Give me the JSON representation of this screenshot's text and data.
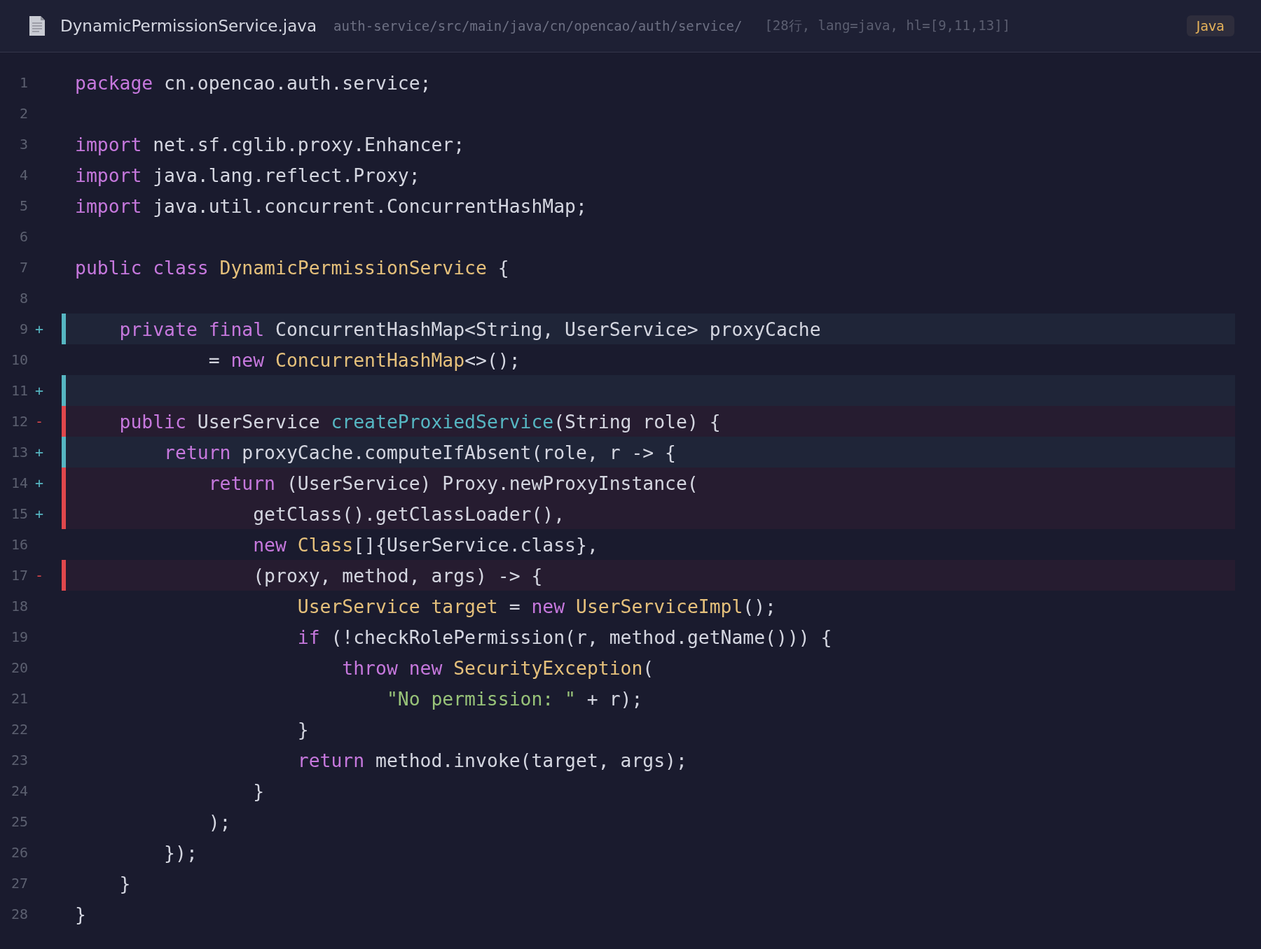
{
  "file": {
    "name": "DynamicPermissionService.java",
    "path": "auth-service/src/main/java/cn/opencao/auth/service/",
    "meta": "[28行, lang=java, hl=[9,11,13]]",
    "language": "Java"
  },
  "lines": [
    {
      "number": "1",
      "kind": "context",
      "tokens": [
        {
          "kind": "kw",
          "text": "package "
        },
        {
          "kind": "plain",
          "text": "cn.opencao.auth.service;"
        }
      ]
    },
    {
      "number": "2",
      "kind": "context"
    },
    {
      "number": "3",
      "kind": "context",
      "tokens": [
        {
          "kind": "kw",
          "text": "import "
        },
        {
          "kind": "plain",
          "text": "net.sf.cglib.proxy.Enhancer;"
        }
      ]
    },
    {
      "number": "4",
      "kind": "context",
      "tokens": [
        {
          "kind": "kw",
          "text": "import "
        },
        {
          "kind": "plain",
          "text": "java.lang.reflect.Proxy;"
        }
      ]
    },
    {
      "number": "5",
      "kind": "context",
      "tokens": [
        {
          "kind": "kw",
          "text": "import "
        },
        {
          "kind": "plain",
          "text": "java.util.concurrent.ConcurrentHashMap;"
        }
      ]
    },
    {
      "number": "6",
      "kind": "context"
    },
    {
      "number": "7",
      "kind": "context",
      "tokens": [
        {
          "kind": "kw",
          "text": "public class "
        },
        {
          "kind": "type",
          "text": "DynamicPermissionService"
        },
        {
          "kind": "plain",
          "text": " {"
        }
      ]
    },
    {
      "number": "8",
      "kind": "context"
    },
    {
      "number": "9",
      "marker": "+",
      "kind": "added",
      "tokens": [
        {
          "kind": "kw",
          "text": "    private final"
        },
        {
          "kind": "plain",
          "text": " ConcurrentHashMap<String, UserService> proxyCache"
        }
      ]
    },
    {
      "number": "10",
      "kind": "context",
      "tokens": [
        {
          "kind": "plain",
          "text": "            = "
        },
        {
          "kind": "kw",
          "text": "new "
        },
        {
          "kind": "type",
          "text": "ConcurrentHashMap"
        },
        {
          "kind": "plain",
          "text": "<>();"
        }
      ]
    },
    {
      "number": "11",
      "marker": "+",
      "kind": "added"
    },
    {
      "number": "12",
      "marker": "-",
      "kind": "removed",
      "tokens": [
        {
          "kind": "kw",
          "text": "    public"
        },
        {
          "kind": "plain",
          "text": " UserService "
        },
        {
          "kind": "fn",
          "text": "createProxiedService"
        },
        {
          "kind": "plain",
          "text": "(String role) {"
        }
      ]
    },
    {
      "number": "13",
      "marker": "+",
      "kind": "added",
      "tokens": [
        {
          "kind": "kw",
          "text": "        return"
        },
        {
          "kind": "plain",
          "text": " proxyCache.computeIfAbsent(role, r -> {"
        }
      ]
    },
    {
      "number": "14",
      "marker": "+",
      "kind": "removed",
      "tokens": [
        {
          "kind": "kw",
          "text": "            return"
        },
        {
          "kind": "plain",
          "text": " (UserService) Proxy.newProxyInstance("
        }
      ]
    },
    {
      "number": "15",
      "marker": "+",
      "kind": "removed",
      "tokens": [
        {
          "kind": "plain",
          "text": "                getClass().getClassLoader(),"
        }
      ]
    },
    {
      "number": "16",
      "kind": "context",
      "tokens": [
        {
          "kind": "kw",
          "text": "                new "
        },
        {
          "kind": "type",
          "text": "Class"
        },
        {
          "kind": "plain",
          "text": "[]{UserService.class},"
        }
      ]
    },
    {
      "number": "17",
      "marker": "-",
      "kind": "removed",
      "tokens": [
        {
          "kind": "plain",
          "text": "                (proxy, method, args) -> {"
        }
      ]
    },
    {
      "number": "18",
      "kind": "context",
      "tokens": [
        {
          "kind": "type",
          "text": "                    UserService target"
        },
        {
          "kind": "plain",
          "text": " = "
        },
        {
          "kind": "kw",
          "text": "new "
        },
        {
          "kind": "type",
          "text": "UserServiceImpl"
        },
        {
          "kind": "plain",
          "text": "();"
        }
      ]
    },
    {
      "number": "19",
      "kind": "context",
      "tokens": [
        {
          "kind": "kw",
          "text": "                    if"
        },
        {
          "kind": "plain",
          "text": " (!checkRolePermission(r, method.getName())) {"
        }
      ]
    },
    {
      "number": "20",
      "kind": "context",
      "tokens": [
        {
          "kind": "kw",
          "text": "                        throw new "
        },
        {
          "kind": "type",
          "text": "SecurityException"
        },
        {
          "kind": "plain",
          "text": "("
        }
      ]
    },
    {
      "number": "21",
      "kind": "context",
      "tokens": [
        {
          "kind": "str",
          "text": "                            \"No permission: \""
        },
        {
          "kind": "plain",
          "text": " + r);"
        }
      ]
    },
    {
      "number": "22",
      "kind": "context",
      "tokens": [
        {
          "kind": "plain",
          "text": "                    }"
        }
      ]
    },
    {
      "number": "23",
      "kind": "context",
      "tokens": [
        {
          "kind": "kw",
          "text": "                    return"
        },
        {
          "kind": "plain",
          "text": " method.invoke(target, args);"
        }
      ]
    },
    {
      "number": "24",
      "kind": "context",
      "tokens": [
        {
          "kind": "plain",
          "text": "                }"
        }
      ]
    },
    {
      "number": "25",
      "kind": "context",
      "tokens": [
        {
          "kind": "plain",
          "text": "            );"
        }
      ]
    },
    {
      "number": "26",
      "kind": "context",
      "tokens": [
        {
          "kind": "plain",
          "text": "        });"
        }
      ]
    },
    {
      "number": "27",
      "kind": "context",
      "tokens": [
        {
          "kind": "plain",
          "text": "    }"
        }
      ]
    },
    {
      "number": "28",
      "kind": "context",
      "tokens": [
        {
          "kind": "plain",
          "text": "}"
        }
      ]
    }
  ]
}
